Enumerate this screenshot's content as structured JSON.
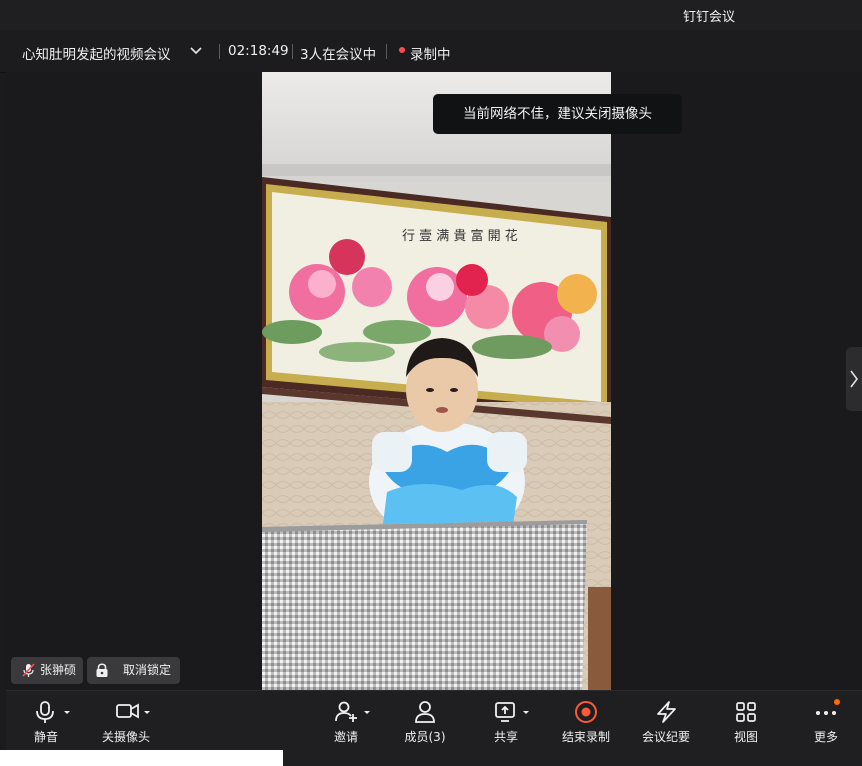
{
  "app": {
    "title": "钉钉会议"
  },
  "meeting": {
    "title": "心知肚明发起的视频会议",
    "duration": "02:18:49",
    "participants": "3人在会议中",
    "recording": "录制中"
  },
  "toast": "当前网络不佳，建议关闭摄像头",
  "speaker": {
    "name": "张翀硕"
  },
  "lock": {
    "label": "取消锁定"
  },
  "toolbar": {
    "mute": "静音",
    "camera": "关摄像头",
    "invite": "邀请",
    "members": "成员(3)",
    "share": "共享",
    "end_record": "结束录制",
    "minutes": "会议纪要",
    "view": "视图",
    "more": "更多"
  },
  "colors": {
    "record": "#ff4d4f",
    "record_button": "#ff5a36",
    "badge": "#ff6a00"
  }
}
